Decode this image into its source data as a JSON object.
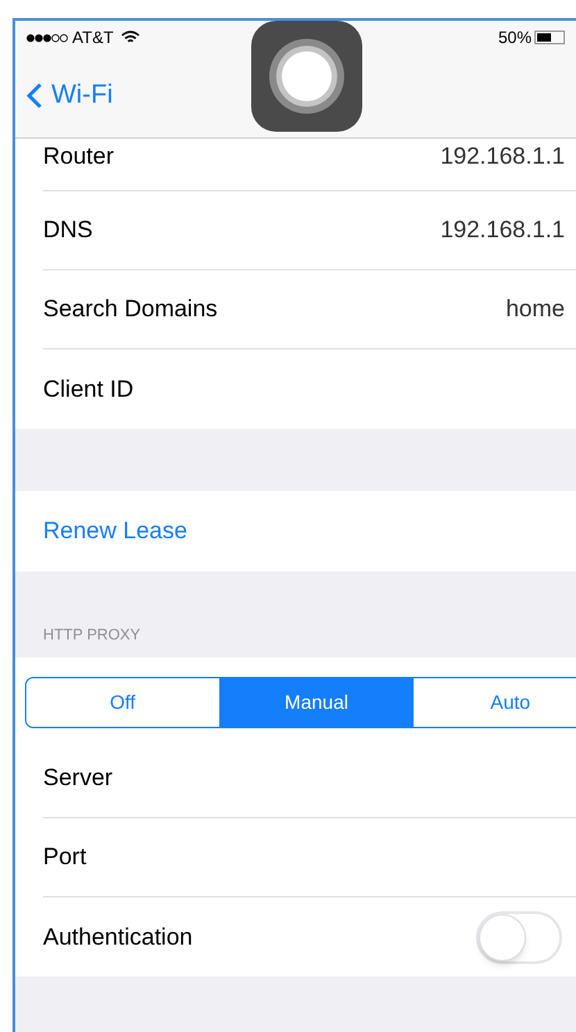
{
  "status_bar": {
    "carrier": "AT&T",
    "battery": "50%"
  },
  "nav": {
    "back": "Wi-Fi"
  },
  "info_rows": [
    {
      "label": "Router",
      "value": "192.168.1.1"
    },
    {
      "label": "DNS",
      "value": "192.168.1.1"
    },
    {
      "label": "Search Domains",
      "value": "home"
    },
    {
      "label": "Client ID"
    }
  ],
  "renew": "Renew Lease",
  "proxy": {
    "header": "HTTP PROXY",
    "segments": [
      {
        "label": "Off",
        "selected": false
      },
      {
        "label": "Manual",
        "selected": true
      },
      {
        "label": "Auto",
        "selected": false
      }
    ],
    "rows": [
      {
        "kind": "text",
        "label": "Server"
      },
      {
        "kind": "text",
        "label": "Port"
      },
      {
        "kind": "switch",
        "label": "Authentication",
        "on": false
      }
    ]
  }
}
